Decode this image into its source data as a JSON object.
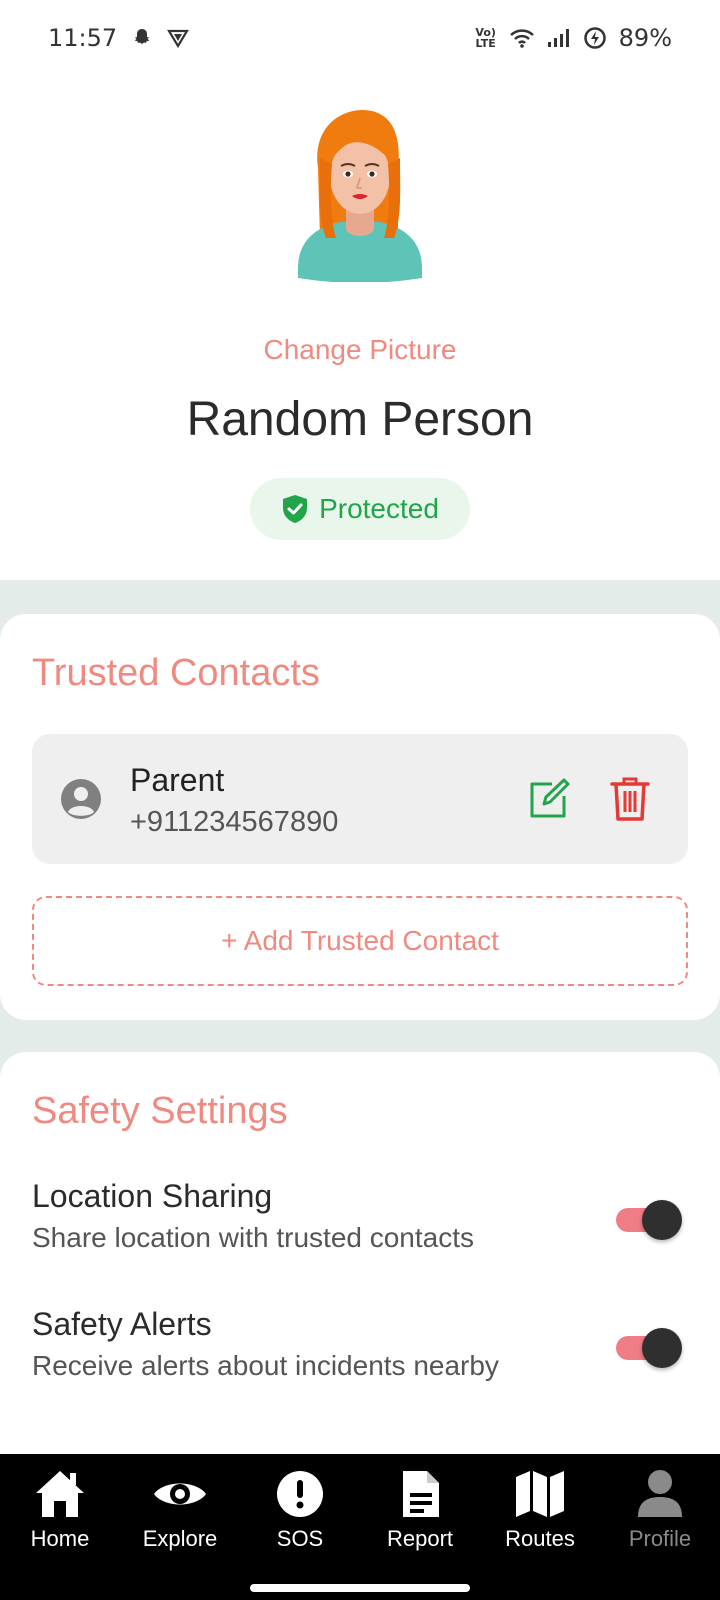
{
  "status_bar": {
    "time": "11:57",
    "network_label": "Vo) LTE",
    "battery": "89%",
    "icons": [
      "snapchat-icon",
      "vpn-shield-icon",
      "volte-icon",
      "wifi-icon",
      "signal-icon",
      "battery-saver-icon"
    ]
  },
  "profile": {
    "change_picture_label": "Change Picture",
    "name": "Random Person",
    "status_label": "Protected",
    "status_color": "#22a54a"
  },
  "trusted_contacts": {
    "title": "Trusted Contacts",
    "contacts": [
      {
        "name": "Parent",
        "phone": "+911234567890"
      }
    ],
    "add_label": "+ Add Trusted Contact"
  },
  "safety_settings": {
    "title": "Safety Settings",
    "items": [
      {
        "title": "Location Sharing",
        "description": "Share location with trusted contacts",
        "enabled": true
      },
      {
        "title": "Safety Alerts",
        "description": "Receive alerts about incidents nearby",
        "enabled": true
      }
    ]
  },
  "nav": {
    "items": [
      {
        "label": "Home",
        "icon": "home-icon"
      },
      {
        "label": "Explore",
        "icon": "eye-icon"
      },
      {
        "label": "SOS",
        "icon": "alert-icon"
      },
      {
        "label": "Report",
        "icon": "document-icon"
      },
      {
        "label": "Routes",
        "icon": "map-icon"
      },
      {
        "label": "Profile",
        "icon": "user-icon"
      }
    ],
    "active": "Profile"
  },
  "colors": {
    "accent": "#f08a80",
    "backdrop": "#e3ece9",
    "toggle_on": "#f07c85",
    "delete": "#e53935",
    "edit": "#22a54a"
  }
}
